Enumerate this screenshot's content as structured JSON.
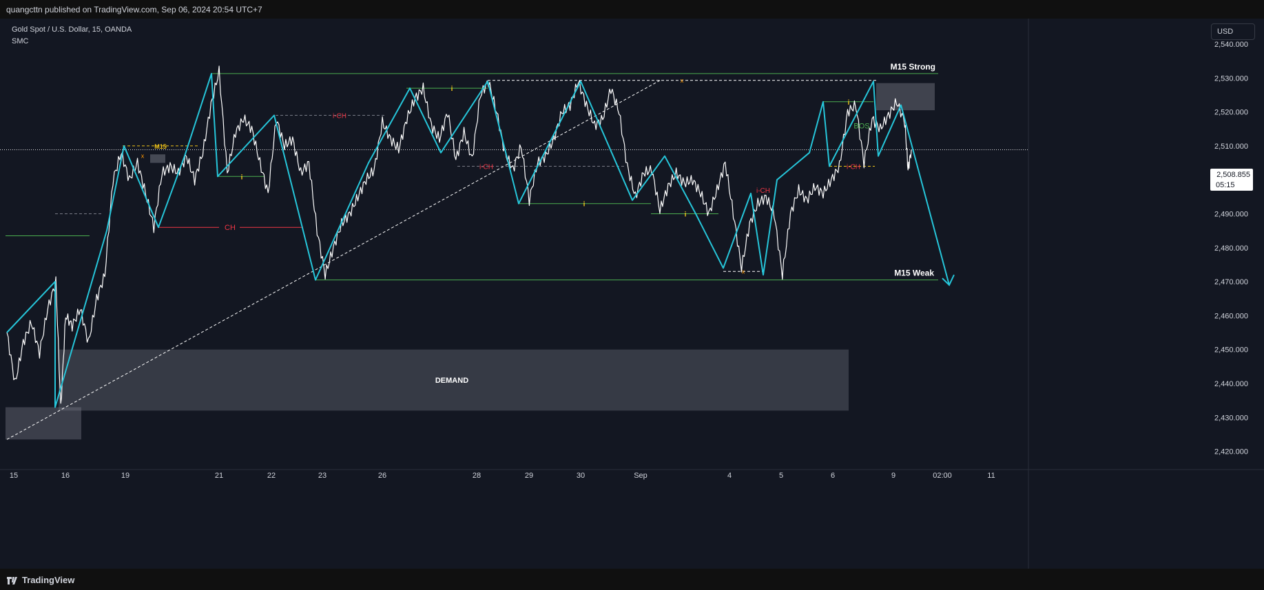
{
  "header": {
    "published_by": "quangcttn published on TradingView.com, Sep 06, 2024 20:54 UTC+7"
  },
  "legend": {
    "symbol": "Gold Spot / U.S. Dollar, 15, OANDA",
    "indicator": "SMC"
  },
  "currency_button": "USD",
  "price_tag": {
    "price": "2,508.855",
    "countdown": "05:15"
  },
  "footer": {
    "brand": "TradingView"
  },
  "colors": {
    "background": "#131722",
    "zigzag": "#26c6da",
    "structure_line": "#4caf50",
    "bearish_label": "#f23645",
    "internal_label": "#f0c419",
    "zone": "#787b86"
  },
  "chart_data": {
    "type": "line",
    "title": "",
    "xlabel": "",
    "ylabel": "",
    "ylim": [
      2415,
      2545
    ],
    "y_ticks": [
      "2,540.000",
      "2,530.000",
      "2,520.000",
      "2,510.000",
      "2,500.000",
      "2,490.000",
      "2,480.000",
      "2,470.000",
      "2,460.000",
      "2,450.000",
      "2,440.000",
      "2,430.000",
      "2,420.000"
    ],
    "y_tick_values": [
      2540,
      2530,
      2520,
      2510,
      2500,
      2490,
      2480,
      2470,
      2460,
      2450,
      2440,
      2430,
      2420
    ],
    "x_ticks": [
      "15",
      "16",
      "19",
      "21",
      "22",
      "23",
      "26",
      "28",
      "29",
      "30",
      "Sep",
      "4",
      "5",
      "6",
      "9",
      "02:00",
      "11"
    ],
    "series": [
      {
        "values": [
          {
            "d": 0,
            "p": 2455
          },
          {
            "d": 0.5,
            "p": 2440
          },
          {
            "d": 1,
            "p": 2452
          },
          {
            "d": 1.5,
            "p": 2458
          },
          {
            "d": 2,
            "p": 2449
          },
          {
            "d": 2.5,
            "p": 2462
          },
          {
            "d": 3,
            "p": 2470
          },
          {
            "d": 3.3,
            "p": 2433
          },
          {
            "d": 3.6,
            "p": 2460
          },
          {
            "d": 4,
            "p": 2457
          },
          {
            "d": 4.5,
            "p": 2462
          },
          {
            "d": 5,
            "p": 2452
          },
          {
            "d": 5.5,
            "p": 2465
          },
          {
            "d": 6,
            "p": 2472
          },
          {
            "d": 6.5,
            "p": 2500
          },
          {
            "d": 7,
            "p": 2508
          },
          {
            "d": 7.5,
            "p": 2500
          },
          {
            "d": 8,
            "p": 2505
          },
          {
            "d": 8.5,
            "p": 2496
          },
          {
            "d": 9,
            "p": 2486
          },
          {
            "d": 9.5,
            "p": 2502
          },
          {
            "d": 10,
            "p": 2504
          },
          {
            "d": 10.5,
            "p": 2502
          },
          {
            "d": 11,
            "p": 2507
          },
          {
            "d": 11.5,
            "p": 2500
          },
          {
            "d": 12,
            "p": 2508
          },
          {
            "d": 12.5,
            "p": 2522
          },
          {
            "d": 13,
            "p": 2532
          },
          {
            "d": 13.5,
            "p": 2502
          },
          {
            "d": 14,
            "p": 2514
          },
          {
            "d": 14.5,
            "p": 2518
          },
          {
            "d": 15,
            "p": 2515
          },
          {
            "d": 15.5,
            "p": 2505
          },
          {
            "d": 16,
            "p": 2496
          },
          {
            "d": 16.5,
            "p": 2518
          },
          {
            "d": 17,
            "p": 2510
          },
          {
            "d": 17.5,
            "p": 2512
          },
          {
            "d": 18,
            "p": 2502
          },
          {
            "d": 18.5,
            "p": 2505
          },
          {
            "d": 19,
            "p": 2485
          },
          {
            "d": 19.5,
            "p": 2472
          },
          {
            "d": 20,
            "p": 2480
          },
          {
            "d": 20.5,
            "p": 2487
          },
          {
            "d": 21,
            "p": 2490
          },
          {
            "d": 21.5,
            "p": 2495
          },
          {
            "d": 22,
            "p": 2500
          },
          {
            "d": 22.5,
            "p": 2503
          },
          {
            "d": 23,
            "p": 2517
          },
          {
            "d": 23.5,
            "p": 2512
          },
          {
            "d": 24,
            "p": 2509
          },
          {
            "d": 24.5,
            "p": 2518
          },
          {
            "d": 25,
            "p": 2524
          },
          {
            "d": 25.5,
            "p": 2527
          },
          {
            "d": 26,
            "p": 2516
          },
          {
            "d": 26.5,
            "p": 2512
          },
          {
            "d": 27,
            "p": 2520
          },
          {
            "d": 27.5,
            "p": 2506
          },
          {
            "d": 28,
            "p": 2514
          },
          {
            "d": 28.5,
            "p": 2506
          },
          {
            "d": 29,
            "p": 2525
          },
          {
            "d": 29.5,
            "p": 2529
          },
          {
            "d": 30,
            "p": 2520
          },
          {
            "d": 30.5,
            "p": 2508
          },
          {
            "d": 31,
            "p": 2503
          },
          {
            "d": 31.5,
            "p": 2510
          },
          {
            "d": 32,
            "p": 2494
          },
          {
            "d": 32.5,
            "p": 2505
          },
          {
            "d": 33,
            "p": 2507
          },
          {
            "d": 33.5,
            "p": 2512
          },
          {
            "d": 34,
            "p": 2520
          },
          {
            "d": 34.5,
            "p": 2522
          },
          {
            "d": 35,
            "p": 2529
          },
          {
            "d": 35.5,
            "p": 2522
          },
          {
            "d": 36,
            "p": 2516
          },
          {
            "d": 36.5,
            "p": 2518
          },
          {
            "d": 37,
            "p": 2527
          },
          {
            "d": 37.5,
            "p": 2520
          },
          {
            "d": 38,
            "p": 2504
          },
          {
            "d": 38.5,
            "p": 2495
          },
          {
            "d": 39,
            "p": 2502
          },
          {
            "d": 39.5,
            "p": 2503
          },
          {
            "d": 40,
            "p": 2491
          },
          {
            "d": 40.5,
            "p": 2498
          },
          {
            "d": 41,
            "p": 2502
          },
          {
            "d": 41.5,
            "p": 2499
          },
          {
            "d": 42,
            "p": 2500
          },
          {
            "d": 42.5,
            "p": 2496
          },
          {
            "d": 43,
            "p": 2490
          },
          {
            "d": 43.5,
            "p": 2497
          },
          {
            "d": 44,
            "p": 2505
          },
          {
            "d": 44.5,
            "p": 2490
          },
          {
            "d": 45,
            "p": 2474
          },
          {
            "d": 45.5,
            "p": 2487
          },
          {
            "d": 46,
            "p": 2493
          },
          {
            "d": 46.5,
            "p": 2495
          },
          {
            "d": 47,
            "p": 2490
          },
          {
            "d": 47.5,
            "p": 2472
          },
          {
            "d": 48,
            "p": 2490
          },
          {
            "d": 48.5,
            "p": 2497
          },
          {
            "d": 49,
            "p": 2494
          },
          {
            "d": 49.5,
            "p": 2498
          },
          {
            "d": 50,
            "p": 2496
          },
          {
            "d": 50.5,
            "p": 2500
          },
          {
            "d": 51,
            "p": 2504
          },
          {
            "d": 51.5,
            "p": 2520
          },
          {
            "d": 52,
            "p": 2522
          },
          {
            "d": 52.5,
            "p": 2505
          },
          {
            "d": 53,
            "p": 2518
          },
          {
            "d": 53.5,
            "p": 2515
          },
          {
            "d": 54,
            "p": 2519
          },
          {
            "d": 54.5,
            "p": 2523
          },
          {
            "d": 55,
            "p": 2517
          },
          {
            "d": 55.2,
            "p": 2503
          },
          {
            "d": 55.4,
            "p": 2508.855
          }
        ]
      }
    ],
    "annotations": [
      {
        "text": "M15 Strong",
        "price": 2531
      },
      {
        "text": "M15 Weak",
        "price": 2471
      },
      {
        "text": "DEMAND",
        "zone": [
          2432,
          2450
        ]
      },
      {
        "text": "CH",
        "price": 2486
      },
      {
        "text": "i-CH",
        "price": 2519
      },
      {
        "text": "i-CH",
        "price": 2504
      },
      {
        "text": "i-CH",
        "price": 2504
      },
      {
        "text": "i-CH",
        "price": 2497
      },
      {
        "text": "BOS",
        "price": 2516
      },
      {
        "text": "M15",
        "price": 2510
      },
      {
        "text": "i",
        "price": 2501
      },
      {
        "text": "i",
        "price": 2527
      },
      {
        "text": "i",
        "price": 2493
      },
      {
        "text": "i",
        "price": 2490
      },
      {
        "text": "i",
        "price": 2523
      },
      {
        "text": "x",
        "price": 2529
      },
      {
        "text": "x",
        "price": 2473
      },
      {
        "text": "x",
        "price": 2507
      }
    ]
  }
}
